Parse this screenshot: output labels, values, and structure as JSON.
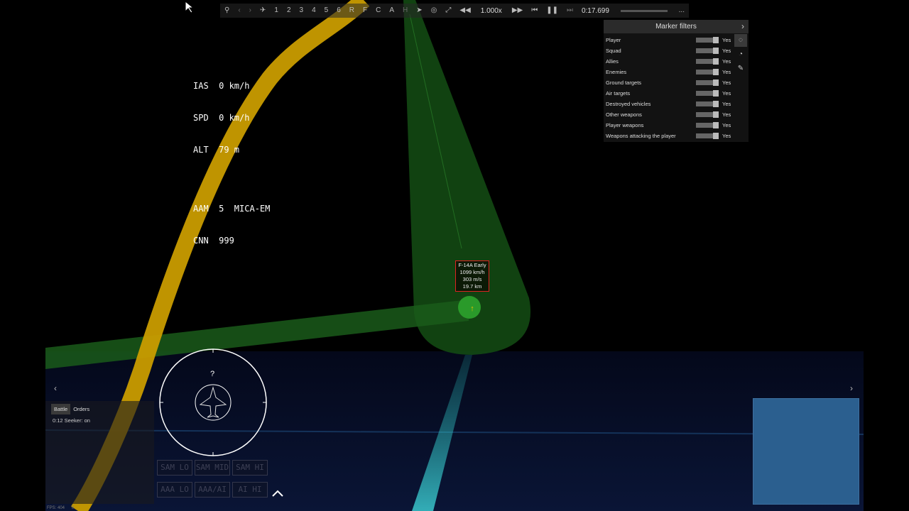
{
  "toolbar": {
    "slots": [
      "1",
      "2",
      "3",
      "4",
      "5",
      "6",
      "R",
      "F",
      "C",
      "A",
      "H"
    ],
    "speed": "1.000x",
    "time": "0:17.699",
    "progress": 0.0,
    "more": "..."
  },
  "hud": {
    "ias": "IAS  0 km/h",
    "spd": "SPD  0 km/h",
    "alt": "ALT  79 m",
    "aam": "AAM  5  MICA-EM",
    "cnn": "CNN  999"
  },
  "filters": {
    "title": "Marker filters",
    "rows": [
      {
        "label": "Player",
        "value": "Yes"
      },
      {
        "label": "Squad",
        "value": "Yes"
      },
      {
        "label": "Allies",
        "value": "Yes"
      },
      {
        "label": "Enemies",
        "value": "Yes"
      },
      {
        "label": "Ground targets",
        "value": "Yes"
      },
      {
        "label": "Air targets",
        "value": "Yes"
      },
      {
        "label": "Destroyed vehicles",
        "value": "Yes"
      },
      {
        "label": "Other weapons",
        "value": "Yes"
      },
      {
        "label": "Player weapons",
        "value": "Yes"
      },
      {
        "label": "Weapons attacking the player",
        "value": "Yes"
      }
    ]
  },
  "target": {
    "name": "F-14A Early",
    "speed": "1099 km/h",
    "climb": "303 m/s",
    "dist": "19.7 km"
  },
  "compass": {
    "heading": "?"
  },
  "chat": {
    "tabs": [
      "Battle",
      "Orders"
    ],
    "message": "0:12 Seeker: on"
  },
  "radio": [
    "SAM LO",
    "SAM MID",
    "SAM HI",
    "AAA LO",
    "AAA/AI",
    "AI HI"
  ],
  "fps": "FPS: 404",
  "fps_extra": "0",
  "colors": {
    "track": "#d4a400",
    "beam": "#1f6b1f",
    "sea": "#0a1230",
    "filterRed": "#d22222"
  }
}
